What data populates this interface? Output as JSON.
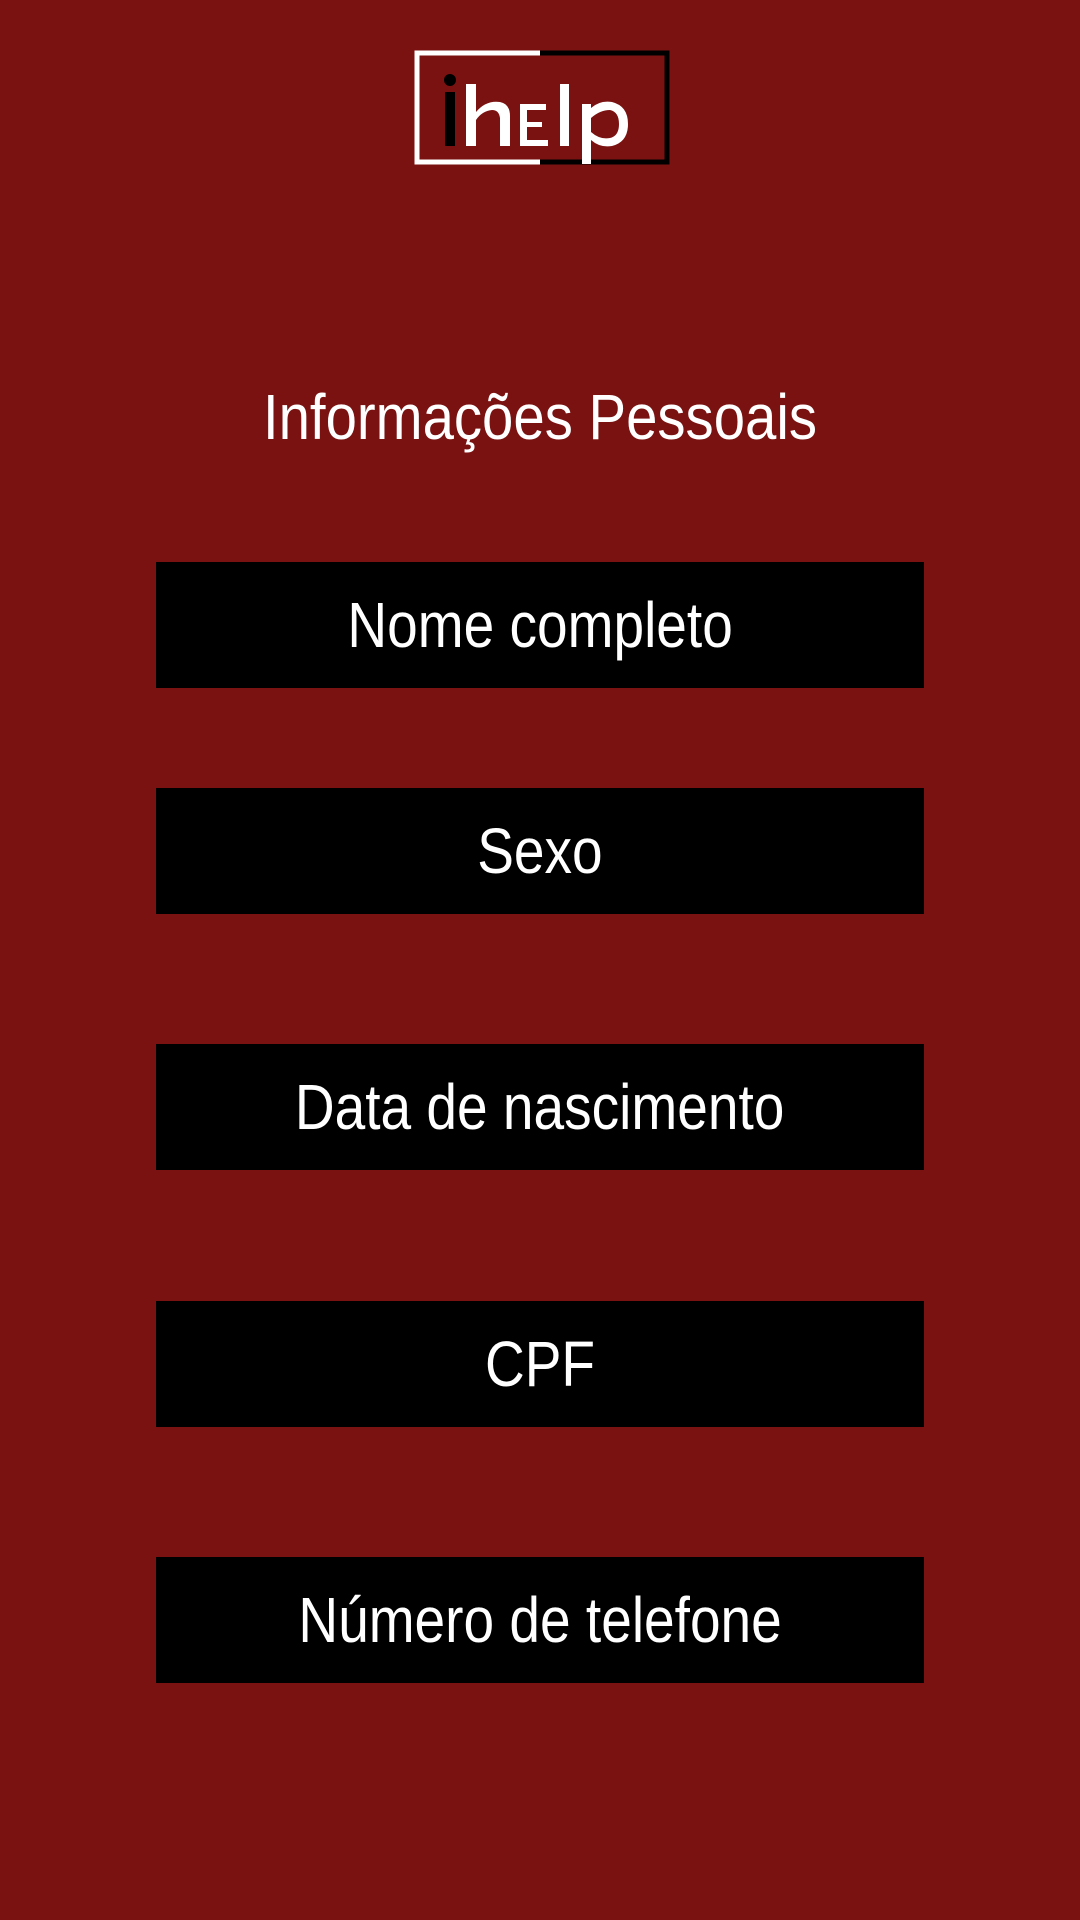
{
  "logo": {
    "text": "ihelp",
    "colors": {
      "white": "#ffffff",
      "black": "#000000"
    }
  },
  "header": {
    "title": "Informações Pessoais"
  },
  "form": {
    "fields": [
      {
        "placeholder": "Nome completo"
      },
      {
        "placeholder": "Sexo"
      },
      {
        "placeholder": "Data de nascimento"
      },
      {
        "placeholder": "CPF"
      },
      {
        "placeholder": "Número de telefone"
      }
    ]
  },
  "theme": {
    "background": "#7b1212",
    "field_background": "#000000",
    "text_color": "#ffffff"
  }
}
